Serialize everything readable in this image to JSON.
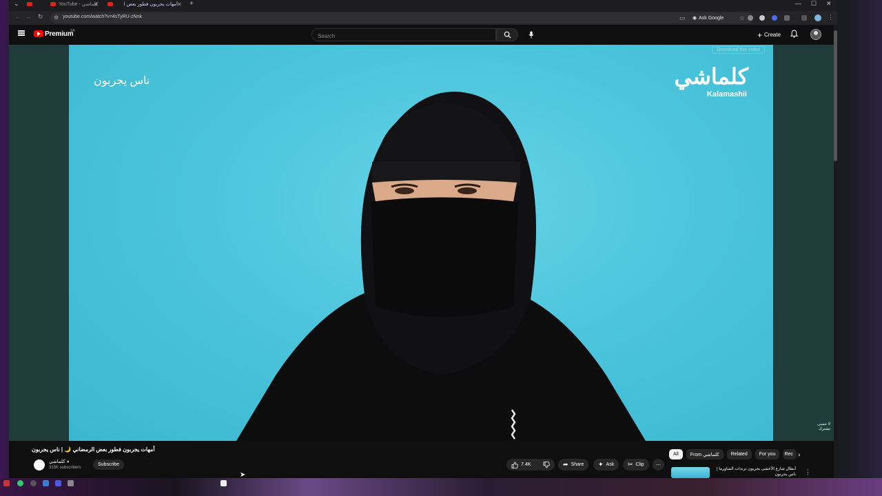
{
  "browser": {
    "tabs": [
      {
        "label": "YouTube - كلماشي",
        "active": false
      },
      {
        "label": "أمهات يجربون فطور بعض ا",
        "active": true
      }
    ],
    "url": "youtube.com/watch?v=4sTyRU-zNnk",
    "ask_google_label": "Ask Google"
  },
  "youtube": {
    "brand": "Premium",
    "region": "SA",
    "search_placeholder": "Search",
    "create_label": "Create"
  },
  "player": {
    "overlay_title": "ناس يجربون",
    "brand_logo_ar": "كلماشي",
    "brand_logo_en": "Kalamashii",
    "download_label": "Download this video",
    "corner_tag": "لا تنسى تشترك"
  },
  "video": {
    "title": "أمهات يجربون فطور بعض الرمضاني 🌙 | ناس يجربون",
    "channel_name": "كلماشي",
    "subscribers": "315K subscribers",
    "subscribe_label": "Subscribe",
    "likes": "7.4K",
    "share_label": "Share",
    "ask_label": "Ask",
    "clip_label": "Clip"
  },
  "chips": [
    "All",
    "From كلماشي",
    "Related",
    "For you",
    "Rec"
  ],
  "recommendation": {
    "title": "أبطال شارع الأعشى يجربون ترندات الشاورما | ناس يجربون"
  },
  "colors": {
    "player_bg": "#4cc5dc",
    "yt_red": "#ff0000",
    "page_bg": "#0f0f0f"
  }
}
